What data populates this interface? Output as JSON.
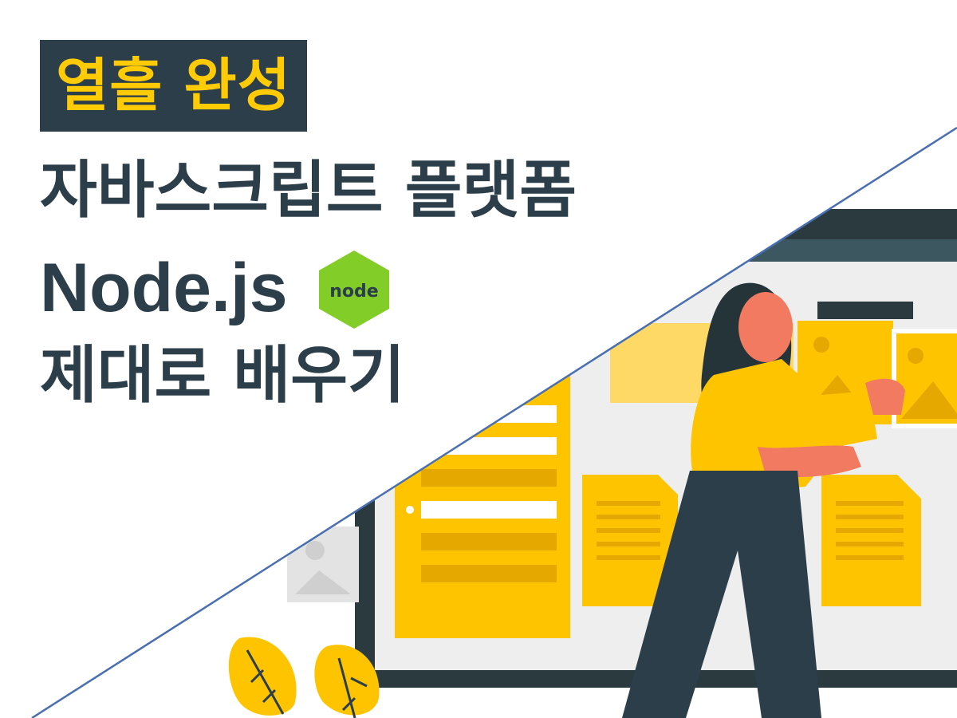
{
  "badge": {
    "text": "열흘 완성"
  },
  "title": {
    "line1": "자바스크립트 플랫폼",
    "line2": "Node.js",
    "line3": "제대로 배우기"
  },
  "logo": {
    "text": "node",
    "icon": "nodejs-hexagon-icon",
    "color": "#83cd29"
  },
  "colors": {
    "accent": "#ffcb05",
    "dark": "#2c3e4a",
    "divider": "#4a6fb0"
  }
}
